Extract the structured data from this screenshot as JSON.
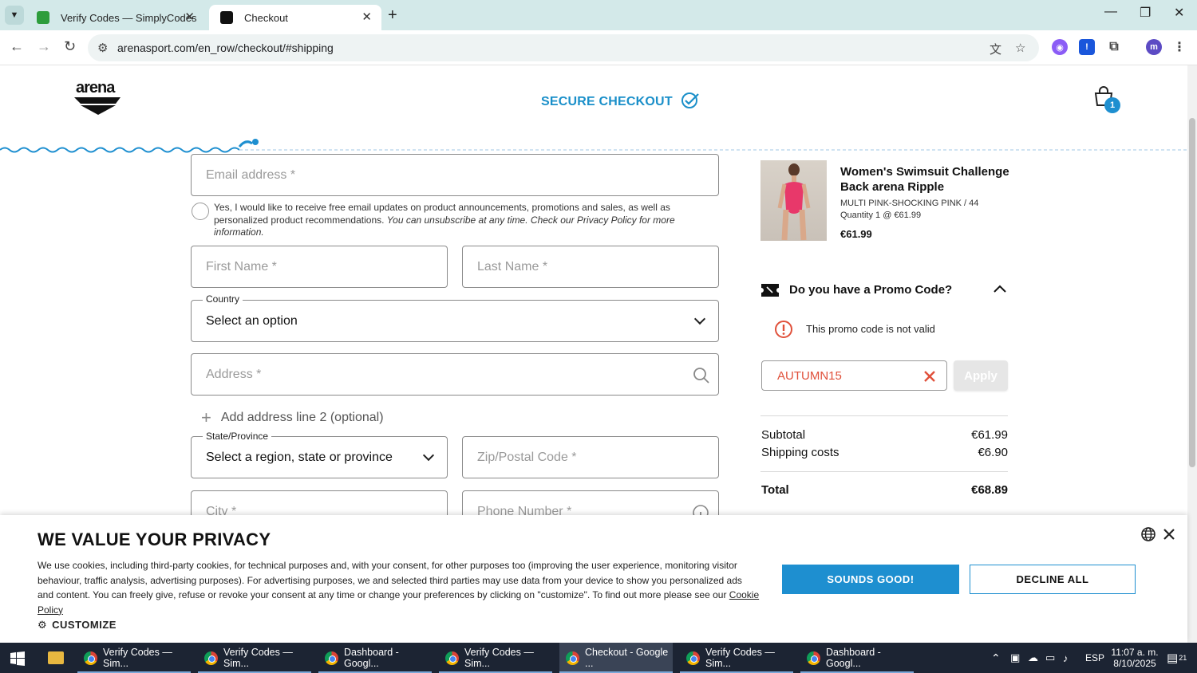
{
  "browser": {
    "tabs": [
      {
        "title": "Verify Codes — SimplyCodes",
        "active": false
      },
      {
        "title": "Checkout",
        "active": true
      }
    ],
    "url": "arenasport.com/en_row/checkout/#shipping"
  },
  "header": {
    "logo_text": "arena",
    "secure_checkout": "SECURE CHECKOUT",
    "cart_count": "1"
  },
  "form": {
    "email_placeholder": "Email address *",
    "consent_text": "Yes, I would like to receive free email updates on product announcements, promotions and sales, as well as personalized product recommendations.",
    "consent_italic": "You can unsubscribe at any time. Check our Privacy Policy for more information.",
    "first_name_placeholder": "First Name  *",
    "last_name_placeholder": "Last Name  *",
    "country_label": "Country",
    "country_value": "Select an option",
    "address_placeholder": "Address  *",
    "add_line2": "Add address line 2 (optional)",
    "state_label": "State/Province",
    "state_value": "Select a region, state or province",
    "zip_placeholder": "Zip/Postal Code  *",
    "city_placeholder": "City  *",
    "phone_placeholder": "Phone Number  *"
  },
  "summary": {
    "product_name": "Women's Swimsuit Challenge Back arena Ripple",
    "product_variant": "MULTI PINK-SHOCKING PINK  /  44",
    "product_qty": "Quantity 1 @ €61.99",
    "product_price": "€61.99",
    "promo_title": "Do you have a Promo Code?",
    "promo_error": "This promo code is not valid",
    "promo_value": "AUTUMN15",
    "apply_label": "Apply",
    "subtotal_label": "Subtotal",
    "subtotal_value": "€61.99",
    "shipping_label": "Shipping costs",
    "shipping_value": "€6.90",
    "total_label": "Total",
    "total_value": "€68.89"
  },
  "privacy": {
    "title": "WE VALUE YOUR PRIVACY",
    "body": "We use cookies, including third-party cookies, for technical purposes and, with your consent, for other purposes too (improving the user experience, monitoring visitor behaviour, traffic analysis, advertising purposes). For advertising purposes, we and selected third parties may use data from your device to show you personalized ads and content. You can freely give, refuse or revoke your consent at any time or change your preferences by clicking on \"customize\". To find out more please see our",
    "link": "Cookie Policy",
    "customize": "CUSTOMIZE",
    "accept": "SOUNDS GOOD!",
    "decline": "DECLINE ALL"
  },
  "taskbar": {
    "items": [
      {
        "label": "Verify Codes — Sim..."
      },
      {
        "label": "Verify Codes — Sim..."
      },
      {
        "label": "Dashboard - Googl..."
      },
      {
        "label": "Verify Codes — Sim..."
      },
      {
        "label": "Checkout - Google ..."
      },
      {
        "label": "Verify Codes — Sim..."
      },
      {
        "label": "Dashboard - Googl..."
      }
    ],
    "lang": "ESP",
    "time": "11:07 a. m.",
    "date": "8/10/2025",
    "notif_count": "21"
  },
  "colors": {
    "accent": "#1e8fd0",
    "error": "#e0503a",
    "tabbar": "#d3e9e9"
  }
}
